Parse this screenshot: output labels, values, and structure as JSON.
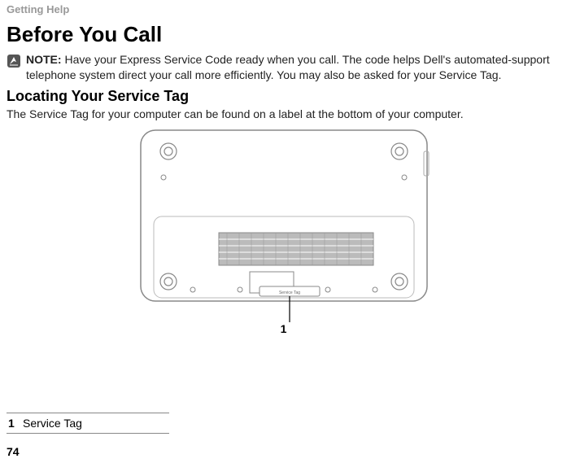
{
  "breadcrumb": "Getting Help",
  "heading": "Before You Call",
  "note_label": "NOTE:",
  "note_body": "Have your Express Service Code ready when you call. The code helps Dell's automated-support telephone system direct your call more efficiently. You may also be asked for your Service Tag.",
  "sub_heading": "Locating Your Service Tag",
  "body": "The Service Tag for your computer can be found on a label at the bottom of your computer.",
  "diagram_label": "Service Tag",
  "callout_number": "1",
  "legend": {
    "num": "1",
    "label": "Service Tag"
  },
  "page_number": "74"
}
